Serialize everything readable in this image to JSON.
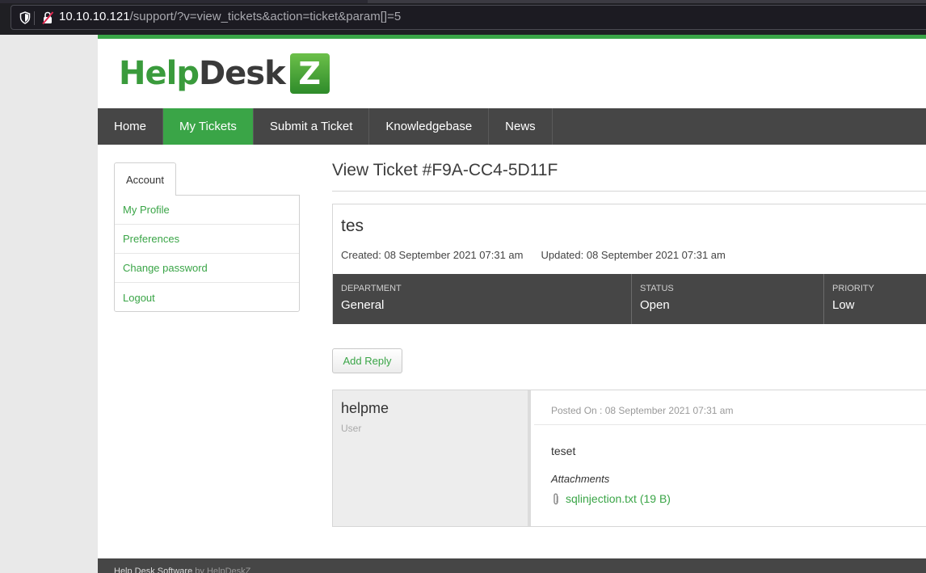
{
  "browser": {
    "url_host": "10.10.10.121",
    "url_path": "/support/?v=view_tickets&action=ticket&param[]=5"
  },
  "logo": {
    "part1": "Help",
    "part2": "Desk",
    "badge": "Z"
  },
  "nav": {
    "items": [
      "Home",
      "My Tickets",
      "Submit a Ticket",
      "Knowledgebase",
      "News"
    ],
    "active": "My Tickets"
  },
  "sidebar": {
    "tab": "Account",
    "links": [
      "My Profile",
      "Preferences",
      "Change password",
      "Logout"
    ]
  },
  "ticket": {
    "heading": "View Ticket #F9A-CC4-5D11F",
    "subject": "tes",
    "created": "Created: 08 September 2021 07:31 am",
    "updated": "Updated: 08 September 2021 07:31 am",
    "props": [
      {
        "label": "Department",
        "value": "General"
      },
      {
        "label": "Status",
        "value": "Open"
      },
      {
        "label": "Priority",
        "value": "Low"
      }
    ],
    "add_reply": "Add Reply"
  },
  "message": {
    "username": "helpme",
    "role": "User",
    "posted": "Posted On : 08 September 2021 07:31 am",
    "body": "teset",
    "attachments_label": "Attachments",
    "attachment": "sqlinjection.txt (19 B)"
  },
  "footer": {
    "text": "Help Desk Software",
    "by": "by HelpDeskZ"
  },
  "colors": {
    "accent": "#3aa547",
    "nav_bg": "#464646"
  }
}
